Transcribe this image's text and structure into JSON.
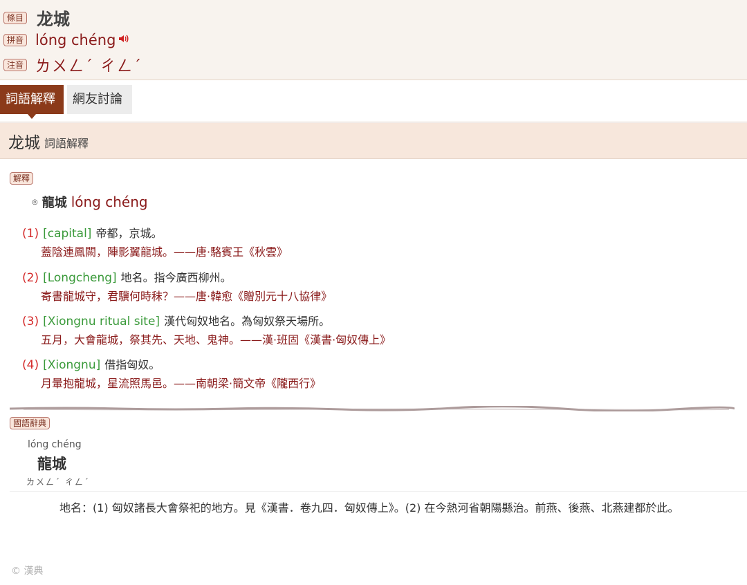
{
  "header": {
    "entry_tag": "條目",
    "title": "龙城",
    "pinyin_tag": "拼音",
    "pinyin": "lóng chéng",
    "speaker_icon": "speaker-icon",
    "zhuyin_tag": "注音",
    "zhuyin": "ㄌㄨㄥˊ ㄔㄥˊ"
  },
  "tabs": [
    {
      "label": "詞語解釋",
      "active": true
    },
    {
      "label": "網友討論",
      "active": false
    }
  ],
  "section": {
    "word": "龙城",
    "subtitle": "詞語解釋"
  },
  "explanation": {
    "tag": "解釋",
    "headword_marker": "◎",
    "headword_traditional": "龍城",
    "headword_pinyin": "lóng chéng",
    "senses": [
      {
        "num": "(1)",
        "en": "[capital]",
        "def": "帝都，京城。",
        "quote": "蓋陰連鳳闕，陣影翼龍城。——唐·駱賓王《秋雲》"
      },
      {
        "num": "(2)",
        "en": "[Longcheng]",
        "def": "地名。指今廣西柳州。",
        "quote": "寄書龍城守，君驥何時秣？——唐·韓愈《贈別元十八協律》"
      },
      {
        "num": "(3)",
        "en": "[Xiongnu ritual site]",
        "def": "漢代匈奴地名。為匈奴祭天場所。",
        "quote": "五月，大會龍城，祭其先、天地、鬼神。——漢·班固《漢書·匈奴傳上》"
      },
      {
        "num": "(4)",
        "en": "[Xiongnu]",
        "def": "借指匈奴。",
        "quote": "月暈抱龍城，星流照馬邑。——南朝梁·簡文帝《隴西行》"
      }
    ]
  },
  "guoyu": {
    "tag": "國語辭典",
    "pinyin": "lóng chéng",
    "word": "龍城",
    "zhuyin": "ㄌㄨㄥˊ ㄔㄥˊ",
    "definition": "地名：(1) 匈奴諸長大會祭祀的地方。見《漢書．卷九四．匈奴傳上》。(2) 在今熱河省朝陽縣治。前燕、後燕、北燕建都於此。"
  },
  "footer": {
    "copyright": "© 漢典"
  },
  "colors": {
    "accent": "#8b3a1a",
    "sense_number": "#d42a2a",
    "english": "#3a9a3a",
    "quote": "#8a1a1a"
  }
}
